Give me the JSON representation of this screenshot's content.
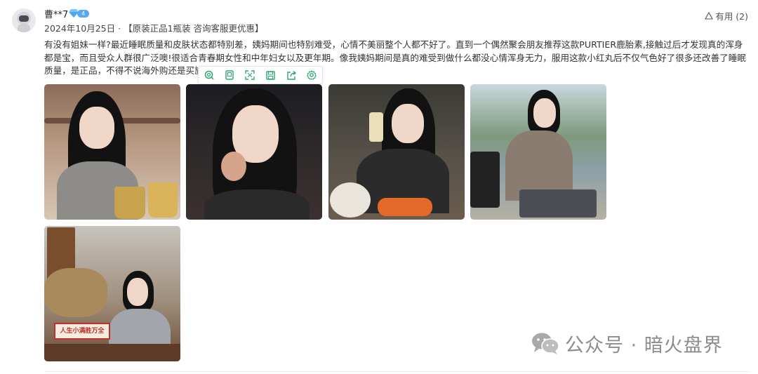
{
  "review": {
    "username": "曹**7",
    "vip_level": "4",
    "date": "2024年10月25日",
    "separator": "·",
    "variant": "【原装正品1瓶装 咨询客服更优惠】",
    "useful_label": "有用 (2)",
    "content": "有没有姐妹一样?最近睡眠质量和皮肤状态都特别差，姨妈期间也特别难受，心情不美丽整个人都不好了。直到一个偶然聚会朋友推荐这款PURTIER鹿胎素,接触过后才发现真的浑身都是宝，而且受众人群很广泛噢!很适合青春期女性和中年妇女以及更年期。像我姨妈期间是真的难受到做什么都没心情浑身无力，服用这款小红丸后不仅气色好了很多还改善了睡眠质量，是正品，不得不说海外购还是买旗舰店靠谱。"
  },
  "photos": [
    {
      "name": "review-photo-1"
    },
    {
      "name": "review-photo-2"
    },
    {
      "name": "review-photo-3"
    },
    {
      "name": "review-photo-4"
    },
    {
      "name": "review-photo-5",
      "sign_text": "人生小满胜万全"
    }
  ],
  "toolbar": {
    "icons": [
      "search-icon",
      "tablet-icon",
      "expand-icon",
      "save-icon",
      "share-icon",
      "settings-icon"
    ]
  },
  "watermark": {
    "icon": "wechat-icon",
    "text": "公众号 · 暗火盘界"
  },
  "colors": {
    "toolbar_icon": "#2aa870",
    "vip_badge": "#58a8f5",
    "watermark": "#8c8c8c"
  }
}
